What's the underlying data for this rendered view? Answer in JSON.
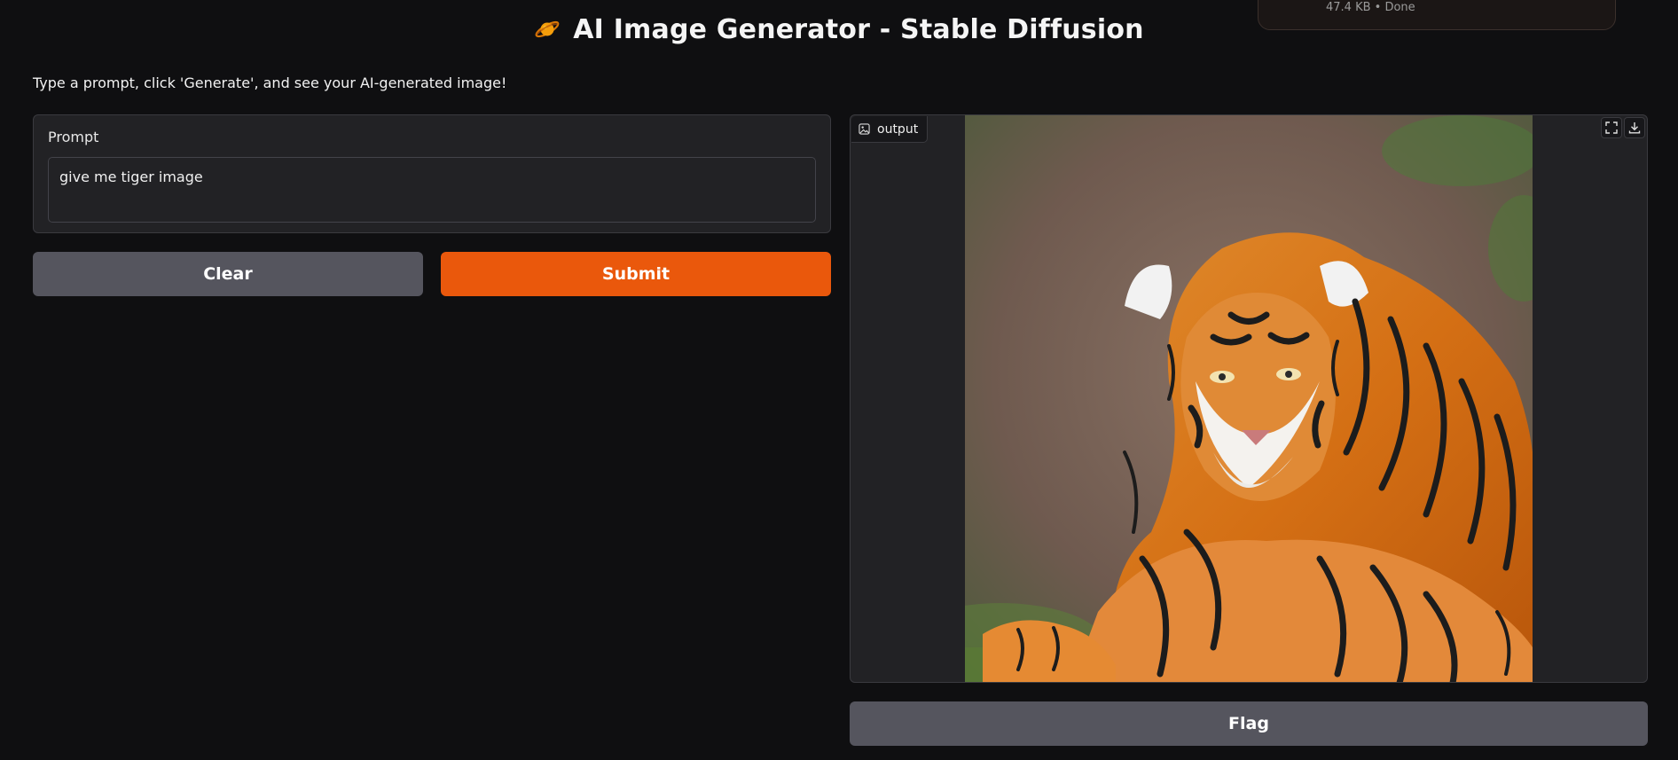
{
  "app": {
    "title": "AI Image Generator - Stable Diffusion",
    "title_icon": "planet-icon",
    "description": "Type a prompt, click 'Generate', and see your AI-generated image!"
  },
  "download_toast": {
    "meta": "47.4 KB • Done"
  },
  "prompt": {
    "label": "Prompt",
    "value": "give me tiger image"
  },
  "buttons": {
    "clear": "Clear",
    "submit": "Submit",
    "flag": "Flag"
  },
  "output": {
    "label": "output",
    "label_icon": "image-icon",
    "actions": [
      "fullscreen-icon",
      "download-icon"
    ],
    "image_subject": "tiger"
  },
  "colors": {
    "background": "#0f0f11",
    "panel": "#222225",
    "accent": "#ea580c",
    "secondary_button": "#55555e"
  }
}
